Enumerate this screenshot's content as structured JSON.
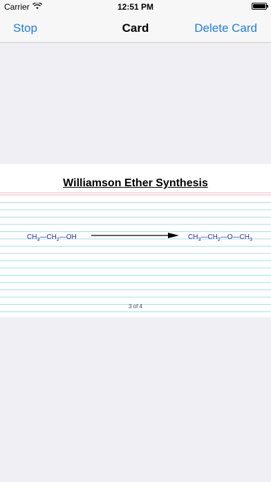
{
  "status_bar": {
    "carrier": "Carrier",
    "time": "12:51 PM",
    "wifi_icon": "wifi-icon",
    "battery_icon": "battery-icon",
    "battery_level": 1.0
  },
  "nav": {
    "left_label": "Stop",
    "title": "Card",
    "right_label": "Delete Card",
    "accent_color": "#1a7ef1"
  },
  "card": {
    "title": "Williamson Ether Synthesis",
    "reactant": {
      "parts": [
        {
          "text": "CH",
          "sub": "3"
        },
        {
          "text": "—CH",
          "sub": "2"
        },
        {
          "text": "—OH",
          "sub": ""
        }
      ]
    },
    "product": {
      "parts": [
        {
          "text": "CH",
          "sub": "3"
        },
        {
          "text": "—CH",
          "sub": "2"
        },
        {
          "text": "—O—CH",
          "sub": "3"
        }
      ]
    },
    "page_indicator": "3 of 4",
    "ruled_line_color": "#a6dcf2",
    "header_line_color": "#f7b8c8",
    "chem_color": "#2a2a9e"
  }
}
